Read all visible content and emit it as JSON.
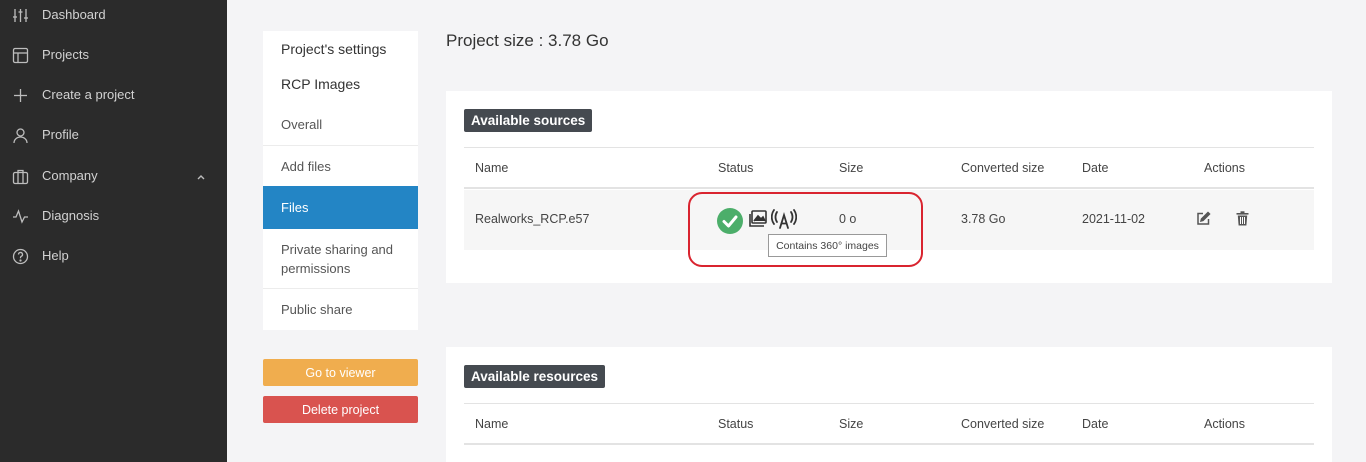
{
  "sidebar": {
    "items": [
      {
        "label": "Dashboard",
        "icon": "sliders-icon"
      },
      {
        "label": "Projects",
        "icon": "layout-icon"
      },
      {
        "label": "Create a project",
        "icon": "plus-icon"
      },
      {
        "label": "Profile",
        "icon": "user-icon"
      },
      {
        "label": "Company",
        "icon": "briefcase-icon"
      },
      {
        "label": "Diagnosis",
        "icon": "activity-icon"
      },
      {
        "label": "Help",
        "icon": "help-circle-icon"
      }
    ]
  },
  "settings_menu": {
    "title": "Project's settings",
    "subtitle": "RCP Images",
    "items": [
      "Overall",
      "Add files",
      "Files",
      "Private sharing and permissions",
      "Public share"
    ],
    "active": "Files"
  },
  "buttons": {
    "viewer": "Go to viewer",
    "delete": "Delete project"
  },
  "project_size": "Project size : 3.78 Go",
  "sources": {
    "title": "Available sources",
    "columns": [
      "Name",
      "Status",
      "Size",
      "Converted size",
      "Date",
      "Actions"
    ],
    "rows": [
      {
        "name": "Realworks_RCP.e57",
        "size": "0 o",
        "converted_size": "3.78 Go",
        "date": "2021-11-02"
      }
    ]
  },
  "tooltip": "Contains 360° images",
  "resources": {
    "title": "Available resources",
    "columns": [
      "Name",
      "Status",
      "Size",
      "Converted size",
      "Date",
      "Actions"
    ]
  },
  "colors": {
    "sidebar_bg": "#2b2b2b",
    "active_blue": "#2385c5",
    "viewer_orange": "#f0ad4e",
    "delete_red": "#d9534f",
    "success_green": "#4cae6a",
    "highlight_red": "#d9242f"
  }
}
